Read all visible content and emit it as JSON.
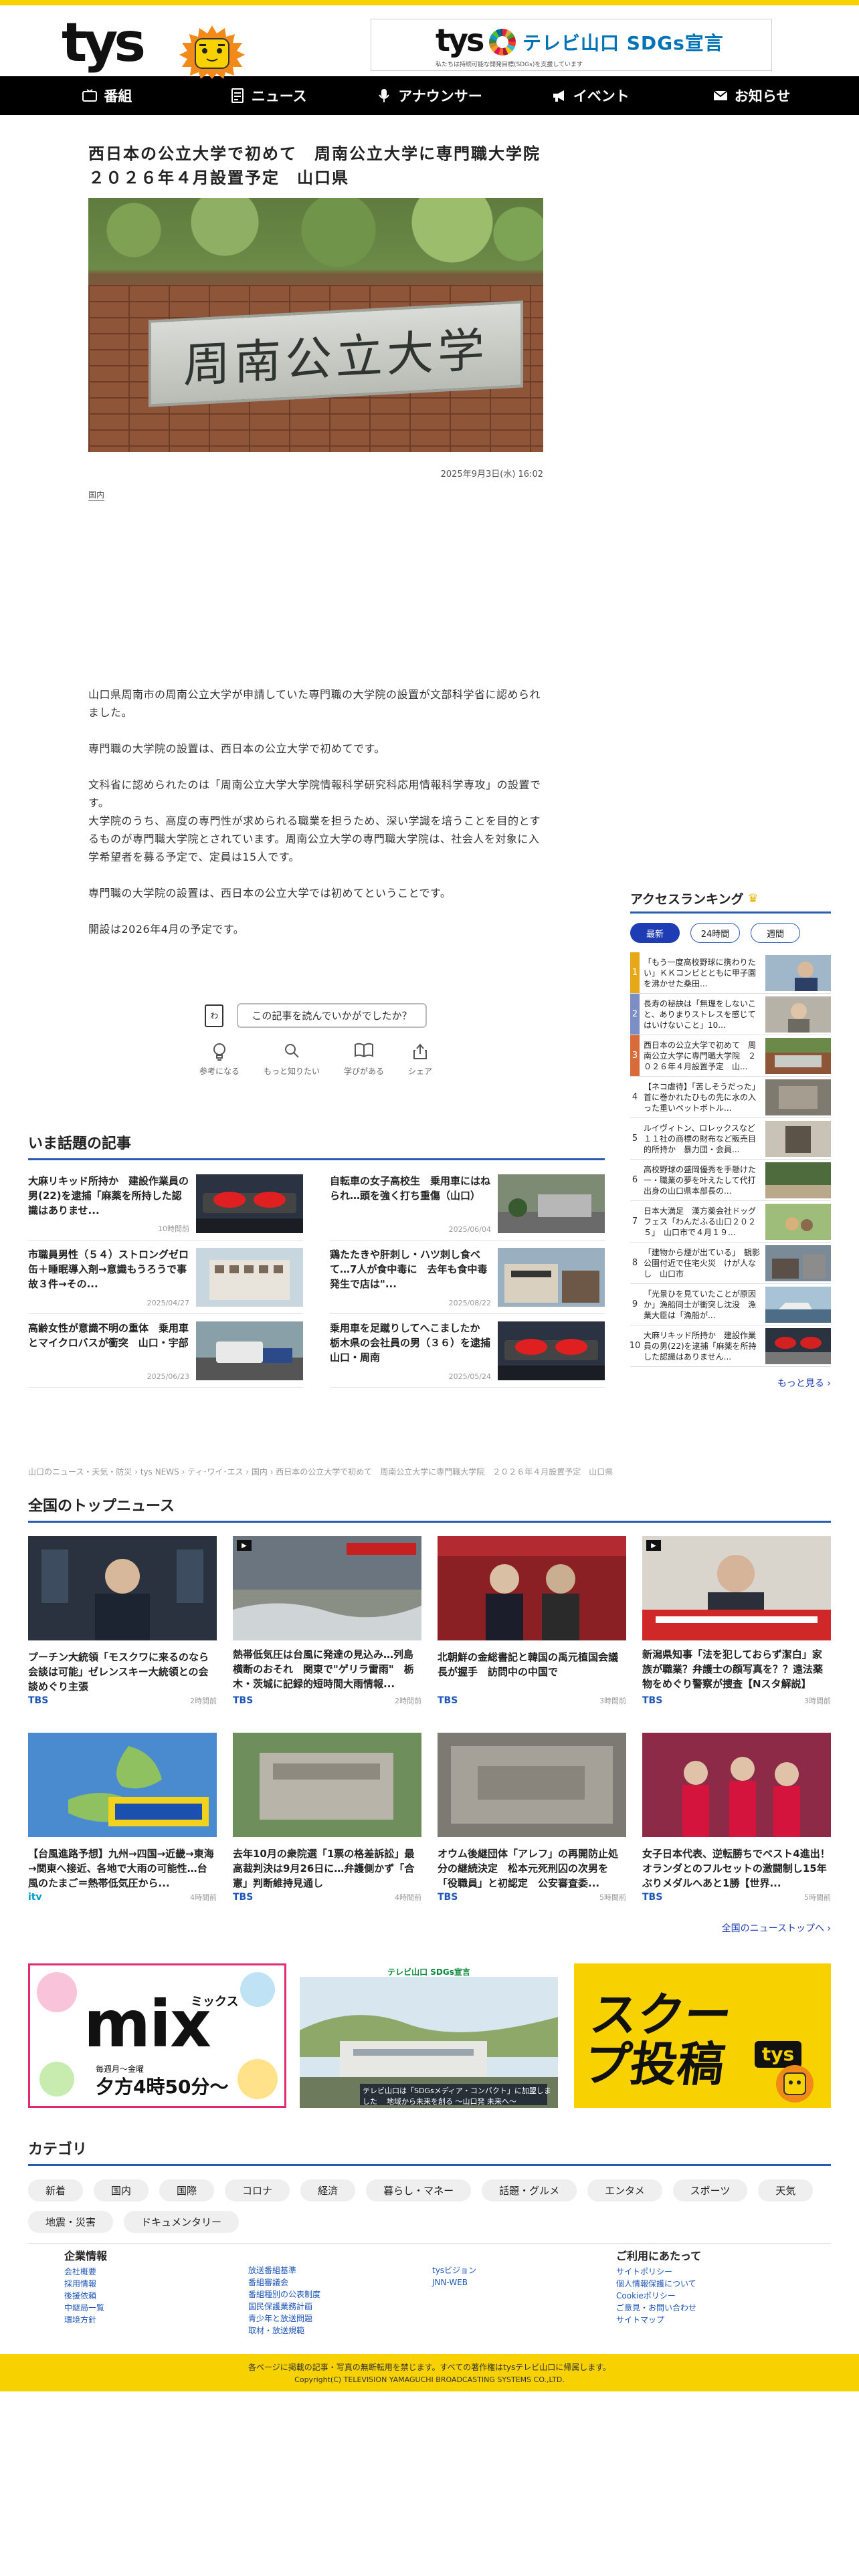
{
  "header": {
    "logo_text": "tys",
    "sdgs_logo_text": "tys",
    "sdgs_title": "テレビ山口 SDGs宣言",
    "sdgs_sub": "私たちは持続可能な開発目標(SDGs)を支援しています"
  },
  "nav": {
    "items": [
      {
        "label": "番組",
        "icon": "tv-icon"
      },
      {
        "label": "ニュース",
        "icon": "news-icon"
      },
      {
        "label": "アナウンサー",
        "icon": "microphone-icon"
      },
      {
        "label": "イベント",
        "icon": "megaphone-icon"
      },
      {
        "label": "お知らせ",
        "icon": "mail-icon"
      }
    ]
  },
  "article": {
    "title": "西日本の公立大学で初めて　周南公立大学に専門職大学院　２０２６年４月設置予定　山口県",
    "hero_text": "周南公立大学",
    "datetime": "2025年9月3日(水) 16:02",
    "tag": "国内",
    "paragraphs": [
      "山口県周南市の周南公立大学が申請していた専門職の大学院の設置が文部科学省に認められました。",
      "専門職の大学院の設置は、西日本の公立大学で初めてです。",
      "文科省に認められたのは「周南公立大学大学院情報科学研究科応用情報科学専攻」の設置です。",
      "大学院のうち、高度の専門性が求められる職業を担うため、深い学識を培うことを目的とするものが専門職大学院とされています。周南公立大学の専門職大学院は、社会人を対象に入学希望者を募る予定で、定員は15人です。",
      "専門職の大学院の設置は、西日本の公立大学では初めてということです。",
      "開設は2026年4月の予定です。"
    ]
  },
  "reaction": {
    "question_icon": "わ",
    "question": "この記事を読んでいかがでしたか？",
    "buttons": [
      {
        "label": "参考になる",
        "icon": "lightbulb-icon"
      },
      {
        "label": "もっと知りたい",
        "icon": "search-icon"
      },
      {
        "label": "学びがある",
        "icon": "book-icon"
      },
      {
        "label": "シェア",
        "icon": "share-icon"
      }
    ]
  },
  "ranking": {
    "title": "アクセスランキング",
    "tabs": [
      "最新",
      "24時間",
      "週間"
    ],
    "items": [
      {
        "num": "1",
        "text": "「もう一度高校野球に携わりたい」ＫＫコンビとともに甲子園を沸かせた桑田..."
      },
      {
        "num": "2",
        "text": "長寿の秘訣は「無理をしないこと、ありまりストレスを感じてはいけないこと」10..."
      },
      {
        "num": "3",
        "text": "西日本の公立大学で初めて　周南公立大学に専門職大学院　２０２６年４月設置予定　山..."
      },
      {
        "num": "4",
        "text": "【ネコ虐待】「苦しそうだった」首に巻かれたひもの先に水の入った重いペットボトル..."
      },
      {
        "num": "5",
        "text": "ルイヴィトン、ロレックスなど１１社の商標の財布など販売目的所持か　暴力団・会員..."
      },
      {
        "num": "6",
        "text": "高校野球の盛岡優秀を手懸けた一・職業の夢を叶えたして代打出身の山口県本部長の..."
      },
      {
        "num": "7",
        "text": "日本大満足　漢方薬会社ドッグフェス「わんだふる山口２０２５」　山口市で４月１９..."
      },
      {
        "num": "8",
        "text": "「建物から煙が出ている」　観影公園付近で住宅火災　けが人なし　山口市"
      },
      {
        "num": "9",
        "text": "「光景ひを見ていたことが原因か」漁船同士が衝突し沈没　漁業大臣は「漁船が..."
      },
      {
        "num": "10",
        "text": "大麻リキッド所持か　建設作業員の男(22)を逮捕「麻薬を所持した認識はありません..."
      }
    ],
    "more": "もっと見る ›"
  },
  "topics": {
    "title": "いま話題の記事",
    "items": [
      {
        "title": "大麻リキッド所持か　建設作業員の男(22)を逮捕「麻薬を所持した認識はありませ...",
        "date": "10時間前"
      },
      {
        "title": "自転車の女子高校生　乗用車にはねられ…頭を強く打ち重傷（山口）",
        "date": "2025/06/04"
      },
      {
        "title": "市職員男性（５４）ストロングゼロ缶＋睡眠導入剤→意識もうろうで事故３件→その...",
        "date": "2025/04/27"
      },
      {
        "title": "鶏たたきや肝刺し・ハツ刺し食べて…7人が食中毒に　去年も食中毒発生で店は\"...",
        "date": "2025/08/22"
      },
      {
        "title": "高齢女性が意識不明の重体　乗用車とマイクロバスが衝突　山口・宇部",
        "date": "2025/06/23"
      },
      {
        "title": "乗用車を足蹴りしてへこましたか　栃木県の会社員の男（３６）を逮捕　山口・周南",
        "date": "2025/05/24"
      }
    ]
  },
  "breadcrumb": "山口のニュース・天気・防災 › tys NEWS › ティ･ワイ･エス › 国内 › 西日本の公立大学で初めて　周南公立大学に専門職大学院　２０２６年４月設置予定　山口県",
  "national": {
    "title": "全国のトップニュース",
    "items": [
      {
        "title": "プーチン大統領「モスクワに来るのなら会談は可能」ゼレンスキー大統領との会談めぐり主張",
        "source": "TBS",
        "time": "2時間前",
        "play": false
      },
      {
        "title": "熱帯低気圧は台風に発達の見込み…列島横断のおそれ　関東で\"ゲリラ雷雨\"　栃木・茨城に記録的短時間大雨情報...",
        "source": "TBS",
        "time": "2時間前",
        "play": true
      },
      {
        "title": "北朝鮮の金総書記と韓国の禹元植国会議長が握手　訪問中の中国で",
        "source": "TBS",
        "time": "3時間前",
        "play": false
      },
      {
        "title": "新潟県知事「法を犯しておらず潔白」家族が職業？弁護士の顔写真を？？遠法薬物をめぐり警察が捜査【Nスタ解説】",
        "source": "TBS",
        "time": "3時間前",
        "play": true
      },
      {
        "title": "【台風進路予想】九州→四国→近畿→東海→関東へ接近、各地で大雨の可能性…台風のたまご＝熱帯低気圧から...",
        "source": "itv",
        "time": "4時間前",
        "play": false
      },
      {
        "title": "去年10月の衆院選「1票の格差訴訟」最高裁判決は9月26日に…弁護側かず「合憲」判断維持見通し",
        "source": "TBS",
        "time": "4時間前",
        "play": false
      },
      {
        "title": "オウム後継団体「アレフ」の再開防止処分の継続決定　松本元死刑囚の次男を「役職員」と初認定　公安審査委...",
        "source": "TBS",
        "time": "5時間前",
        "play": false
      },
      {
        "title": "女子日本代表、逆転勝ちでベスト4進出！オランダとのフルセットの激闘制し15年ぶりメダルへあと1勝【世界...",
        "source": "TBS",
        "time": "5時間前",
        "play": false
      }
    ],
    "more": "全国のニューストップへ ›"
  },
  "banners": {
    "mix_title": "mix",
    "mix_ruby": "ミックス",
    "mix_time": "夕方4時50分〜",
    "mix_sub": "毎週月〜金曜",
    "sdgs_caption": "テレビ山口 SDGs宣言",
    "sdgs_banner_text": "テレビ山口は「SDGsメディア・コンパクト」に加盟しました",
    "sdgs_banner_sub": "地域から未来を創る ～山口発 未来へ～",
    "scoop_title": "スクープ投稿",
    "scoop_logo": "tys"
  },
  "categories": {
    "title": "カテゴリ",
    "items": [
      "新着",
      "国内",
      "国際",
      "コロナ",
      "経済",
      "暮らし・マネー",
      "話題・グルメ",
      "エンタメ",
      "スポーツ",
      "天気",
      "地震・災害",
      "ドキュメンタリー"
    ]
  },
  "footer_links": [
    {
      "title": "企業情報",
      "links": [
        "会社概要",
        "採用情報",
        "後援依頼",
        "中継局一覧",
        "環境方針"
      ]
    },
    {
      "title": "",
      "links": [
        "放送番組基準",
        "番組審議会",
        "番組種別の公表制度",
        "国民保護業務計画",
        "青少年と放送問題",
        "取材・放送規範"
      ]
    },
    {
      "title": "",
      "links": [
        "tysビジョン",
        "JNN-WEB"
      ]
    },
    {
      "title": "ご利用にあたって",
      "links": [
        "サイトポリシー",
        "個人情報保護について",
        "Cookieポリシー",
        "ご意見・お問い合わせ",
        "サイトマップ"
      ]
    }
  ],
  "footer": {
    "notice": "各ページに掲載の記事・写真の無断転用を禁じます。すべての著作権はtysテレビ山口に帰属します。",
    "copyright": "Copyright(C) TELEVISION YAMAGUCHI BROADCASTING SYSTEMS CO.,LTD."
  },
  "colors": {
    "accent_yellow": "#f7d200",
    "accent_blue": "#2a5bb3",
    "nav_bg": "#000000"
  }
}
